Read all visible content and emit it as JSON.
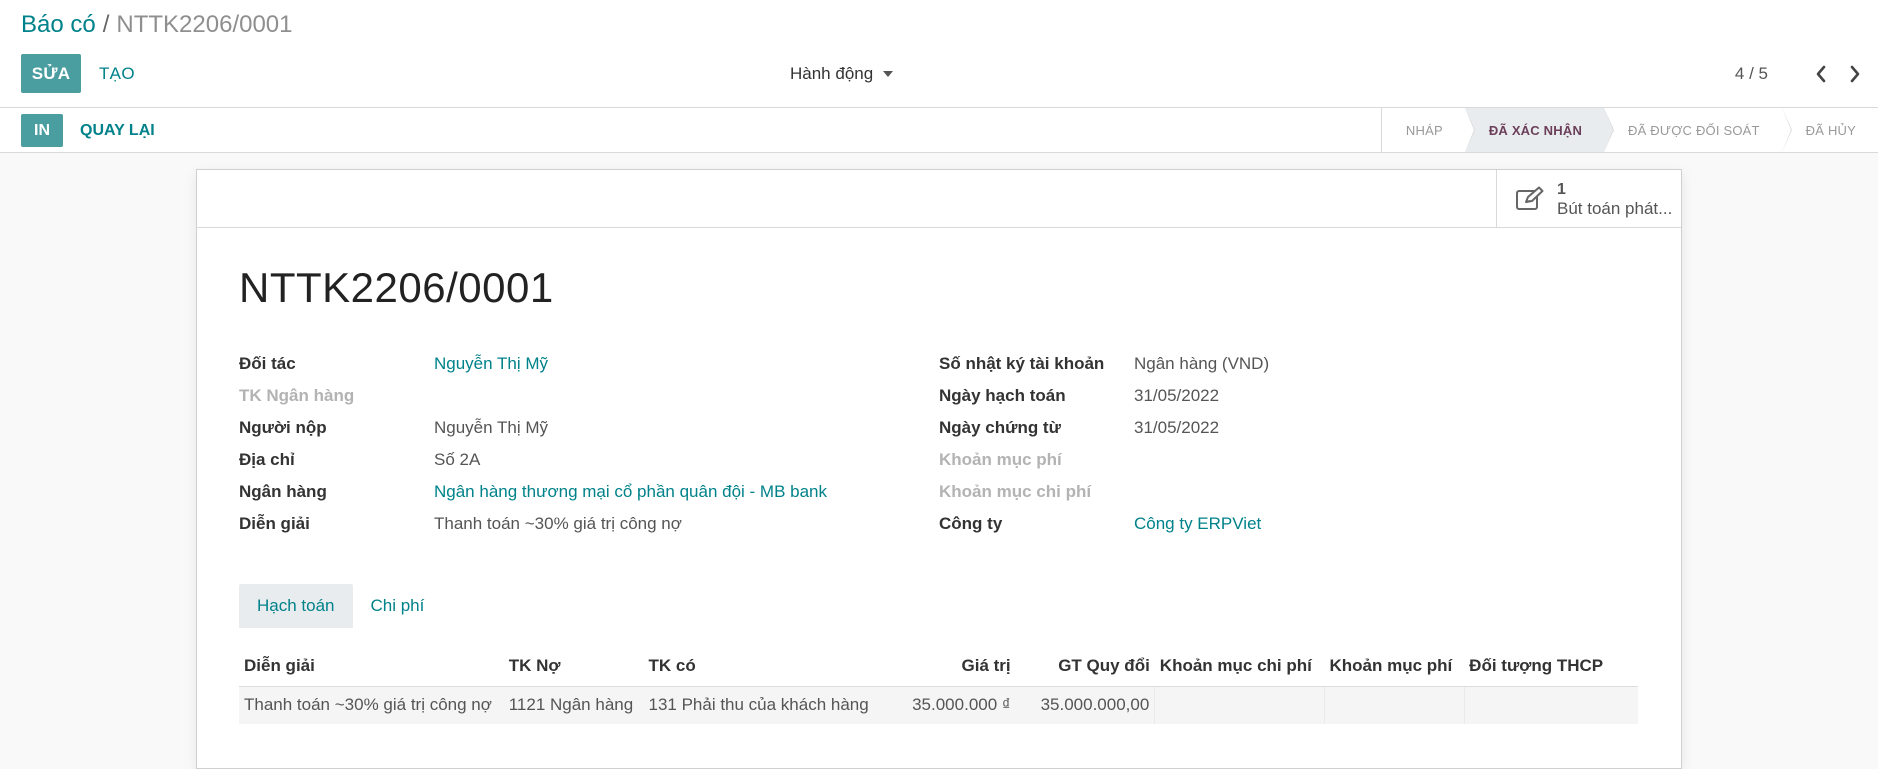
{
  "breadcrumb": {
    "parent": "Báo có",
    "separator": "/",
    "current": "NTTK2206/0001"
  },
  "control": {
    "edit_label": "SỬA",
    "create_label": "TẠO",
    "action_label": "Hành động",
    "pager_value": "4 / 5"
  },
  "statusbar": {
    "print_label": "IN",
    "back_label": "QUAY LẠI",
    "stages": [
      {
        "label": "NHÁP",
        "active": false
      },
      {
        "label": "ĐÃ XÁC NHẬN",
        "active": true
      },
      {
        "label": "ĐÃ ĐƯỢC ĐỐI SOÁT",
        "active": false
      },
      {
        "label": "ĐÃ HỦY",
        "active": false
      }
    ]
  },
  "smart_button": {
    "count": "1",
    "label": "Bút toán phát..."
  },
  "record": {
    "title": "NTTK2206/0001"
  },
  "left_fields": [
    {
      "label": "Đối tác",
      "value": "Nguyễn Thị Mỹ",
      "link": true,
      "muted": false
    },
    {
      "label": "TK Ngân hàng",
      "value": "",
      "link": false,
      "muted": true
    },
    {
      "label": "Người nộp",
      "value": "Nguyễn Thị Mỹ",
      "link": false,
      "muted": false
    },
    {
      "label": "Địa chỉ",
      "value": "Số 2A",
      "link": false,
      "muted": false
    },
    {
      "label": "Ngân hàng",
      "value": "Ngân hàng thương mại cổ phần quân đội - MB bank",
      "link": true,
      "muted": false
    },
    {
      "label": "Diễn giải",
      "value": "Thanh toán ~30% giá trị công nợ",
      "link": false,
      "muted": false
    }
  ],
  "right_fields": [
    {
      "label": "Số nhật ký tài khoản",
      "value": "Ngân hàng (VND)",
      "link": false,
      "muted": false
    },
    {
      "label": "Ngày hạch toán",
      "value": "31/05/2022",
      "link": false,
      "muted": false
    },
    {
      "label": "Ngày chứng từ",
      "value": "31/05/2022",
      "link": false,
      "muted": false
    },
    {
      "label": "Khoản mục phí",
      "value": "",
      "link": false,
      "muted": true
    },
    {
      "label": "Khoản mục chi phí",
      "value": "",
      "link": false,
      "muted": true
    },
    {
      "label": "Công ty",
      "value": "Công ty ERPViet",
      "link": true,
      "muted": false
    }
  ],
  "tabs": [
    {
      "label": "Hạch toán",
      "active": true
    },
    {
      "label": "Chi phí",
      "active": false
    }
  ],
  "table": {
    "headers": [
      "Diễn giải",
      "TK Nợ",
      "TK có",
      "Giá trị",
      "GT Quy đổi",
      "Khoản mục chi phí",
      "Khoản mục phí",
      "Đối tượng THCP"
    ],
    "rows": [
      [
        "Thanh toán ~30% giá trị công nợ",
        "1121 Ngân hàng",
        "131 Phải thu của khách hàng",
        "35.000.000 ₫",
        "35.000.000,00",
        "",
        "",
        ""
      ]
    ]
  },
  "colors": {
    "primary": "#4b9ea0",
    "link": "#00828a",
    "active_stage_text": "#6b3f5a"
  }
}
